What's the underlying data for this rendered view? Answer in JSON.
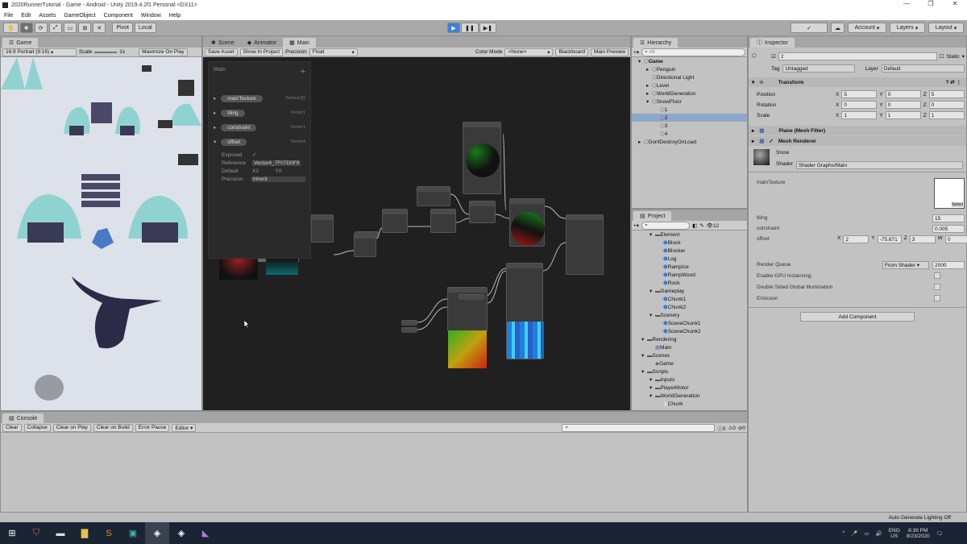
{
  "window": {
    "title": "2020RunnerTutorial - Game - Android - Unity 2019.4.2f1 Personal <DX11>",
    "controls": [
      "—",
      "❐",
      "✕"
    ]
  },
  "menu": [
    "File",
    "Edit",
    "Assets",
    "GameObject",
    "Component",
    "Window",
    "Help"
  ],
  "toolbar": {
    "pivot": "Pivot",
    "local": "Local",
    "account": "Account",
    "layers": "Layers",
    "layout": "Layout",
    "collab": "✓"
  },
  "game": {
    "tab": "Game",
    "aspect": "16:9 Portrait (9:16)",
    "scale_label": "Scale",
    "scale_value": "1x",
    "maximize": "Maximize On Play"
  },
  "graph": {
    "tabs": [
      "Scene",
      "Animator",
      "Main"
    ],
    "save": "Save Asset",
    "show": "Show In Project",
    "precision_label": "Precision",
    "precision": "Float",
    "color_mode_label": "Color Mode",
    "color_mode": "<None>",
    "blackboard": "Blackboard",
    "main_preview": "Main Preview",
    "bb": {
      "title": "Main",
      "properties": [
        {
          "name": "mainTexture",
          "type": "Texture2D"
        },
        {
          "name": "tiling",
          "type": "Vector1"
        },
        {
          "name": "constraint",
          "type": "Vector1"
        },
        {
          "name": "offset",
          "type": "Vector4"
        }
      ],
      "exposed_label": "Exposed",
      "reference_label": "Reference",
      "reference": "Vector4_7F07D0F9",
      "default_label": "Default",
      "default_x": "2",
      "default_y": "0",
      "precision_label": "Precision",
      "precision": "Inherit"
    }
  },
  "hierarchy": {
    "tab": "Hierarchy",
    "add": "+▾",
    "search": "All",
    "items": [
      {
        "label": "Game",
        "depth": 0,
        "arrow": "▾",
        "bold": true
      },
      {
        "label": "Penguin",
        "depth": 1,
        "arrow": "▸"
      },
      {
        "label": "Directional Light",
        "depth": 1,
        "arrow": ""
      },
      {
        "label": "Level",
        "depth": 1,
        "arrow": "▸"
      },
      {
        "label": "WorldGeneration",
        "depth": 1,
        "arrow": "▸"
      },
      {
        "label": "SnowFloor",
        "depth": 1,
        "arrow": "▾"
      },
      {
        "label": "1",
        "depth": 2,
        "arrow": ""
      },
      {
        "label": "2",
        "depth": 2,
        "arrow": "",
        "selected": true
      },
      {
        "label": "3",
        "depth": 2,
        "arrow": ""
      },
      {
        "label": "4",
        "depth": 2,
        "arrow": ""
      },
      {
        "label": "DontDestroyOnLoad",
        "depth": 0,
        "arrow": "▸"
      }
    ]
  },
  "project": {
    "tab": "Project",
    "add": "+▾",
    "count": "12",
    "items": [
      {
        "label": "Element",
        "depth": 1,
        "type": "folder"
      },
      {
        "label": "Block",
        "depth": 2,
        "type": "prefab"
      },
      {
        "label": "Blocker",
        "depth": 2,
        "type": "prefab"
      },
      {
        "label": "Log",
        "depth": 2,
        "type": "prefab"
      },
      {
        "label": "RampIce",
        "depth": 2,
        "type": "prefab"
      },
      {
        "label": "RampWood",
        "depth": 2,
        "type": "prefab"
      },
      {
        "label": "Rock",
        "depth": 2,
        "type": "prefab"
      },
      {
        "label": "Gameplay",
        "depth": 1,
        "type": "folder"
      },
      {
        "label": "Chunk1",
        "depth": 2,
        "type": "prefab"
      },
      {
        "label": "Chunk2",
        "depth": 2,
        "type": "prefab"
      },
      {
        "label": "Scenery",
        "depth": 1,
        "type": "folder"
      },
      {
        "label": "SceneChunk1",
        "depth": 2,
        "type": "prefab"
      },
      {
        "label": "SceneChunk2",
        "depth": 2,
        "type": "prefab"
      },
      {
        "label": "Rendering",
        "depth": 0,
        "type": "folder"
      },
      {
        "label": "Main",
        "depth": 1,
        "type": "shader"
      },
      {
        "label": "Scenes",
        "depth": 0,
        "type": "folder"
      },
      {
        "label": "Game",
        "depth": 1,
        "type": "scene"
      },
      {
        "label": "Scripts",
        "depth": 0,
        "type": "folder"
      },
      {
        "label": "Inputs",
        "depth": 1,
        "type": "folder"
      },
      {
        "label": "PlayerMotor",
        "depth": 1,
        "type": "folder"
      },
      {
        "label": "WorldGeneration",
        "depth": 1,
        "type": "folder"
      },
      {
        "label": "Chunk",
        "depth": 2,
        "type": "script"
      }
    ]
  },
  "inspector": {
    "tab": "Inspector",
    "name": "2",
    "static": "Static",
    "tag_label": "Tag",
    "tag": "Untagged",
    "layer_label": "Layer",
    "layer": "Default",
    "transform": {
      "title": "Transform",
      "rows": [
        {
          "label": "Position",
          "x": "5",
          "y": "0",
          "z": "5"
        },
        {
          "label": "Rotation",
          "x": "0",
          "y": "0",
          "z": "0"
        },
        {
          "label": "Scale",
          "x": "1",
          "y": "1",
          "z": "1"
        }
      ]
    },
    "mesh_filter": "Plane (Mesh Filter)",
    "mesh_renderer": "Mesh Renderer",
    "material": {
      "name": "Snow",
      "shader_label": "Shader",
      "shader": "Shader Graphs/Main",
      "main_texture": "mainTexture",
      "select": "Select",
      "tiling_label": "tiling",
      "tiling": "15",
      "constraint_label": "constraint",
      "constraint": "0.005",
      "offset_label": "offset",
      "offset_x": "2",
      "offset_y": "-75.671",
      "offset_z": "3",
      "offset_w": "0",
      "render_queue_label": "Render Queue",
      "render_queue_mode": "From Shader",
      "render_queue": "2000",
      "gpu_instancing": "Enable GPU Instancing",
      "dsgi": "Double Sided Global Illumination",
      "emission": "Emission"
    },
    "add_component": "Add Component"
  },
  "console": {
    "tab": "Console",
    "buttons": [
      "Clear",
      "Collapse",
      "Clear on Play",
      "Clear on Build",
      "Error Pause",
      "Editor ▾"
    ],
    "counts": [
      "0",
      "0",
      "0"
    ]
  },
  "status": {
    "lighting": "Auto Generate Lighting Off"
  },
  "taskbar": {
    "lang": "ENG",
    "region": "US",
    "time": "8:39 PM",
    "date": "8/23/2020"
  }
}
